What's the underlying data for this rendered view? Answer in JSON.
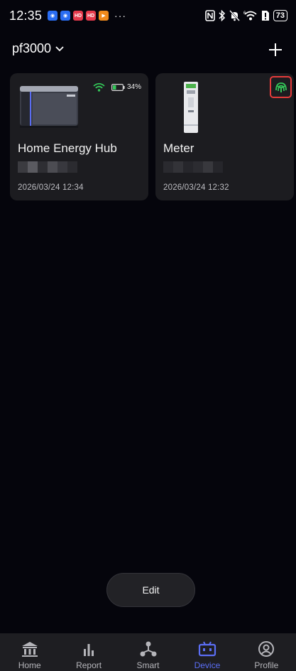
{
  "status_bar": {
    "time": "12:35",
    "notifications": [
      {
        "icon": "app-notification-icon",
        "color": "#2a6df3",
        "glyph": "◉"
      },
      {
        "icon": "app-notification-icon",
        "color": "#2a6df3",
        "glyph": "◉"
      },
      {
        "icon": "hdr-app-icon",
        "color": "#e53a4c",
        "glyph": "HD"
      },
      {
        "icon": "hdr-app-icon",
        "color": "#e53a4c",
        "glyph": "HD"
      },
      {
        "icon": "video-app-icon",
        "color": "#f08a1b",
        "glyph": "▶"
      }
    ],
    "more": "···",
    "battery": "73"
  },
  "header": {
    "home_name": "pf3000",
    "add_icon": "plus-icon",
    "dropdown_icon": "chevron-down-icon"
  },
  "devices": [
    {
      "name": "Home Energy Hub",
      "timestamp": "2026/03/24 12:34",
      "battery_pct_label": "34%",
      "battery_level": 0.34,
      "wifi_color": "#34c759"
    },
    {
      "name": "Meter",
      "timestamp": "2026/03/24 12:32",
      "signal_color": "#34c759",
      "highlight_color": "#e53b3b"
    }
  ],
  "edit_label": "Edit",
  "nav": {
    "active_color": "#5b6ef5",
    "items": [
      {
        "label": "Home",
        "icon": "home-icon"
      },
      {
        "label": "Report",
        "icon": "bar-chart-icon"
      },
      {
        "label": "Smart",
        "icon": "network-icon"
      },
      {
        "label": "Device",
        "icon": "device-icon"
      },
      {
        "label": "Profile",
        "icon": "profile-icon"
      }
    ]
  }
}
